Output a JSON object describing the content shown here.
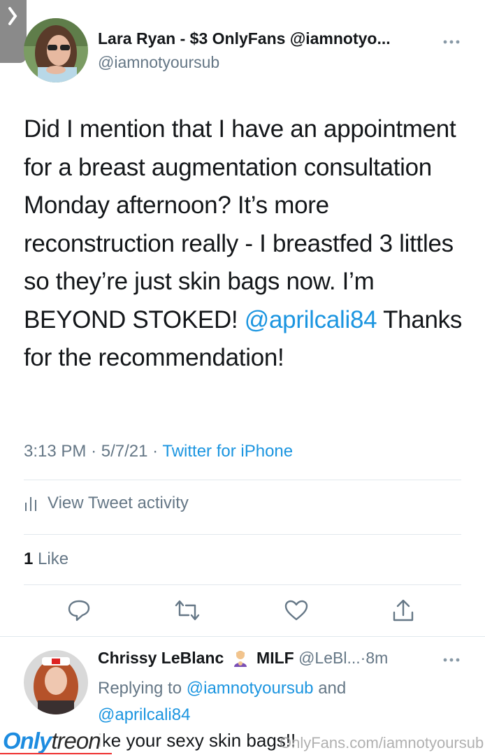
{
  "tweet": {
    "author_name": "Lara Ryan - $3 OnlyFans @iamnotyo...",
    "author_handle": "@iamnotyoursub",
    "text_before": "Did I mention that I have an appointment for a breast augmentation consultation Monday afternoon? It’s more reconstruction really - I breastfed 3 littles so they’re just skin bags now. I’m BEYOND STOKED! ",
    "text_mention": "@aprilcali84",
    "text_after": " Thanks for the recommendation!",
    "time": "3:13 PM",
    "date": "5/7/21",
    "sep": "·",
    "source": "Twitter for iPhone",
    "activity_label": "View Tweet activity",
    "like_count": "1",
    "like_label": "Like"
  },
  "reply": {
    "name": "Chrissy LeBlanc",
    "badge": "MILF",
    "handle": "@LeBl...",
    "sep": "·",
    "time": "8m",
    "replying_prefix": "Replying to ",
    "replying_user1": "@iamnotyoursub",
    "replying_and": " and",
    "replying_user2": "@aprilcali84",
    "text": "ike your sexy skin bags!!"
  },
  "watermark": {
    "logo_part1": "Only",
    "logo_part2": "treon",
    "url": "OnlyFans.com/iamnotyoursub"
  },
  "colors": {
    "link": "#1b95e0",
    "secondary": "#657786",
    "primary": "#14171a",
    "divider": "#e1e8ed"
  },
  "icons": [
    "back-chevron-icon",
    "more-icon",
    "activity-chart-icon",
    "reply-icon",
    "retweet-icon",
    "like-icon",
    "share-icon",
    "emoji-icon"
  ]
}
